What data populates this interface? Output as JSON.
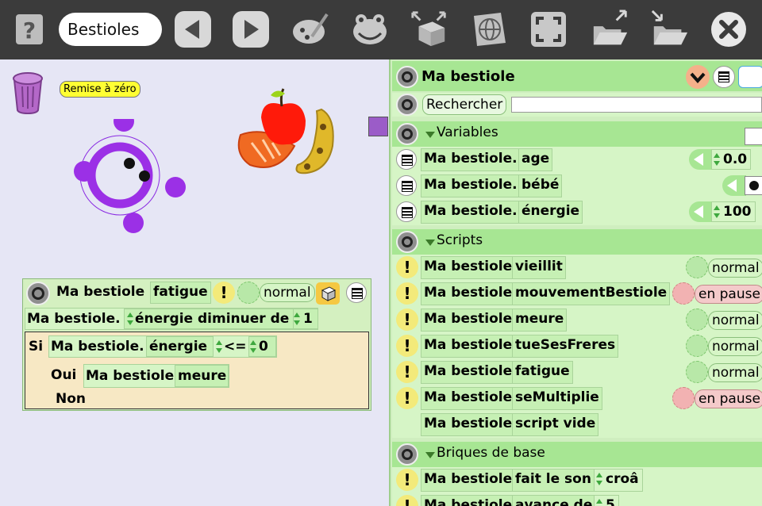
{
  "toolbar": {
    "help_icon": "question-icon",
    "project_name": "Bestioles",
    "buttons": [
      "previous-page-icon",
      "next-page-icon",
      "paint-icon",
      "frog-icon",
      "supplies-icon",
      "world-icon",
      "fullscreen-icon",
      "publish-icon",
      "open-icon",
      "close-icon"
    ]
  },
  "world": {
    "reset_label": "Remise à zéro"
  },
  "script": {
    "object": "Ma bestiole",
    "name": "fatigue",
    "status": "normal",
    "line1_object": "Ma bestiole.",
    "line1_action": "énergie diminuer de",
    "line1_value": "1",
    "if_label": "Si",
    "cond_object": "Ma bestiole.",
    "cond_var": "énergie",
    "cond_op": "<=",
    "cond_value": "0",
    "yes_label": "Oui",
    "yes_object": "Ma bestiole",
    "yes_action": "meure",
    "no_label": "Non"
  },
  "viewer": {
    "title": "Ma bestiole",
    "search_label": "Rechercher",
    "variables_header": "Variables",
    "variables": [
      {
        "object": "Ma bestiole.",
        "name": "age",
        "value": "0.0"
      },
      {
        "object": "Ma bestiole.",
        "name": "bébé",
        "value": ""
      },
      {
        "object": "Ma bestiole.",
        "name": "énergie",
        "value": "100"
      }
    ],
    "scripts_header": "Scripts",
    "scripts": [
      {
        "object": "Ma bestiole",
        "name": "vieillit",
        "status": "normal"
      },
      {
        "object": "Ma bestiole",
        "name": "mouvementBestiole",
        "status": "en pause"
      },
      {
        "object": "Ma bestiole",
        "name": "meure",
        "status": "normal"
      },
      {
        "object": "Ma bestiole",
        "name": "tueSesFreres",
        "status": "normal"
      },
      {
        "object": "Ma bestiole",
        "name": "fatigue",
        "status": "normal"
      },
      {
        "object": "Ma bestiole",
        "name": "seMultiplie",
        "status": "en pause"
      },
      {
        "object": "Ma bestiole",
        "name": "script vide",
        "status": ""
      }
    ],
    "basic_header": "Briques de base",
    "basic": [
      {
        "object": "Ma bestiole",
        "name": "fait le son",
        "value": "croâ"
      },
      {
        "object": "Ma bestiole",
        "name": "avance de",
        "value": "5"
      }
    ]
  },
  "colors": {
    "toolbar": "#3b3b3b",
    "world": "#e6e6f5",
    "viewer": "#cfeebf",
    "accent_yellow": "#ffff33"
  }
}
